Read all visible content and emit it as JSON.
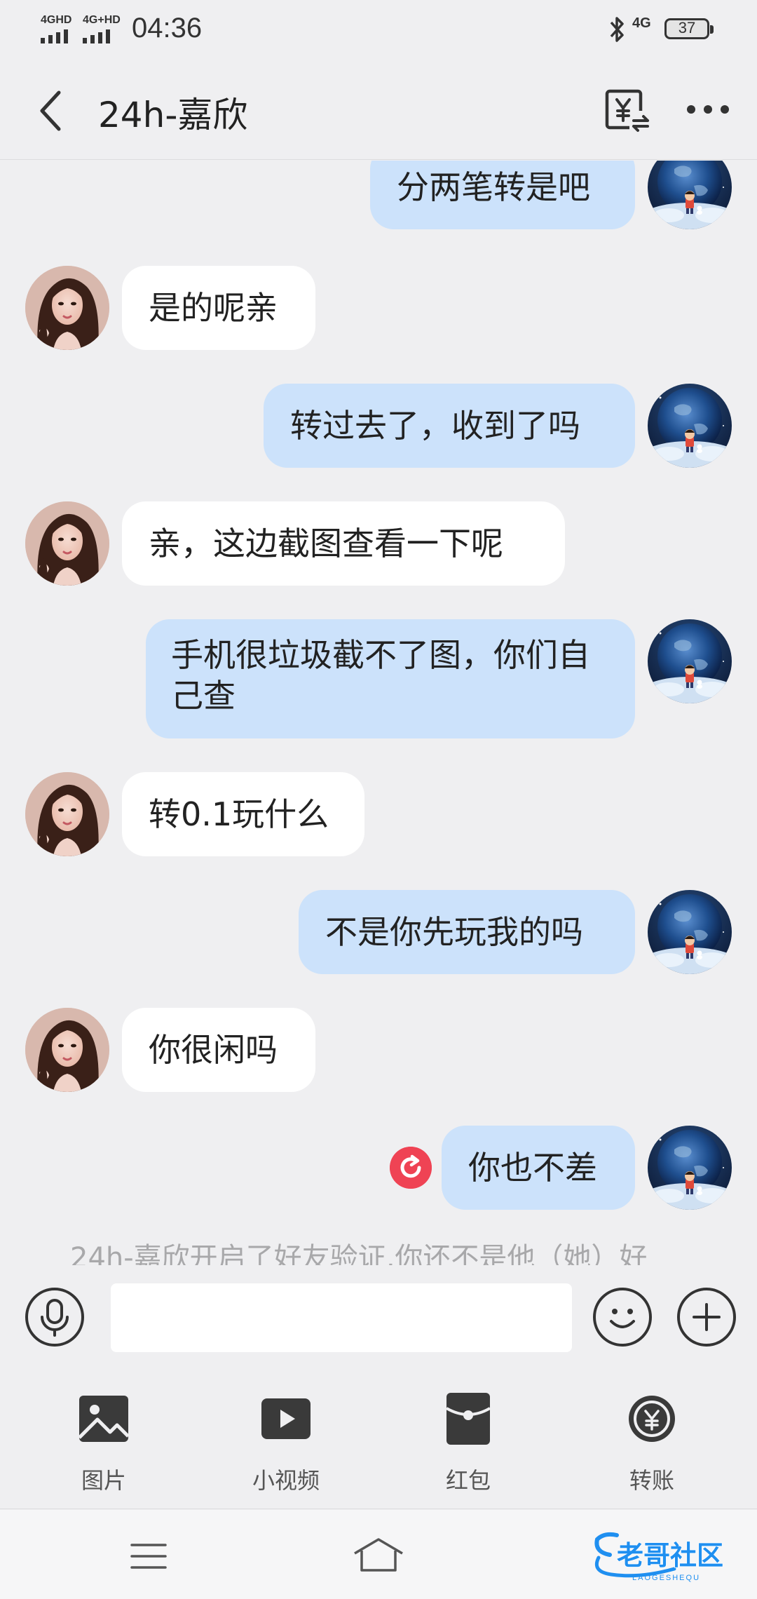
{
  "status_bar": {
    "signal1": "4GHD",
    "signal2": "4G+HD",
    "time": "04:36",
    "network": "4G",
    "battery": "37"
  },
  "header": {
    "title": "24h-嘉欣"
  },
  "messages": [
    {
      "side": "out",
      "text": "分两笔转是吧"
    },
    {
      "side": "in",
      "text": "是的呢亲"
    },
    {
      "side": "out",
      "text": "转过去了，收到了吗"
    },
    {
      "side": "in",
      "text": "亲，这边截图查看一下呢"
    },
    {
      "side": "out",
      "text": "手机很垃圾截不了图，你们自己查"
    },
    {
      "side": "in",
      "text": "转0.1玩什么"
    },
    {
      "side": "out",
      "text": "不是你先玩我的吗"
    },
    {
      "side": "in",
      "text": "你很闲吗"
    },
    {
      "side": "out",
      "text": "你也不差",
      "failed": true
    }
  ],
  "system_notice": "24h-嘉欣开启了好友验证,你还不是他（她）好",
  "input": {
    "value": "",
    "placeholder": ""
  },
  "tools": [
    {
      "label": "图片",
      "icon": "image-icon"
    },
    {
      "label": "小视频",
      "icon": "video-icon"
    },
    {
      "label": "红包",
      "icon": "red-packet-icon"
    },
    {
      "label": "转账",
      "icon": "transfer-icon"
    }
  ],
  "watermark": {
    "text": "老哥社区",
    "subtext": "LAOGESHEQU"
  },
  "colors": {
    "background": "#efeff1",
    "outgoing_bubble": "#cce2fb",
    "incoming_bubble": "#ffffff",
    "resend_icon": "#ef4354",
    "watermark": "#1f8ff0"
  }
}
